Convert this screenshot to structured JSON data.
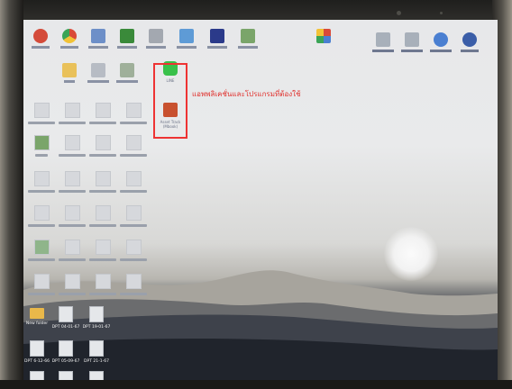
{
  "taskbar_icons": [
    {
      "name": "settings-icon",
      "label": "",
      "color": "#d44b3a"
    },
    {
      "name": "chrome-icon",
      "label": "",
      "color": "#e8b43a"
    },
    {
      "name": "app-icon",
      "label": "",
      "color": "#4a7fd1"
    },
    {
      "name": "app-icon",
      "label": "",
      "color": "#3a8a3a"
    },
    {
      "name": "app-icon",
      "label": "",
      "color": "#8a8f9a"
    },
    {
      "name": "app-icon",
      "label": "",
      "color": "#6aa4d8"
    },
    {
      "name": "app-icon",
      "label": "",
      "color": "#2b3a8a"
    },
    {
      "name": "app-icon",
      "label": "",
      "color": "#6a9a5a"
    },
    {
      "name": "app-icon",
      "label": "",
      "color": "#c85a4a"
    }
  ],
  "right_icons": [
    {
      "name": "app-icon",
      "color": "#9aa3ad"
    },
    {
      "name": "app-icon",
      "color": "#9aa3ad"
    },
    {
      "name": "app-icon",
      "color": "#4a7fd1"
    },
    {
      "name": "facebook-icon",
      "color": "#3b5ea8"
    }
  ],
  "highlighted_apps": [
    {
      "name": "line-icon",
      "label": "LINE",
      "color": "#39c14a"
    },
    {
      "name": "toolbox-icon",
      "label": "Asset Track (Mbook)",
      "color": "#c8512f"
    }
  ],
  "annotation": "แอพพลิเคชั่นและโปรแกรมที่ต้องใช้",
  "bottom_items": [
    {
      "name": "new-folder",
      "label": "New folder"
    },
    {
      "name": "file-icon",
      "label": "DPT 04-01-67"
    },
    {
      "name": "file-icon",
      "label": "DPT 19-01-67"
    },
    {
      "name": "file-icon",
      "label": "DPT 6-12-66"
    },
    {
      "name": "file-icon",
      "label": "DPT 05-09-67"
    },
    {
      "name": "file-icon",
      "label": "DPT 21-1-67"
    }
  ]
}
